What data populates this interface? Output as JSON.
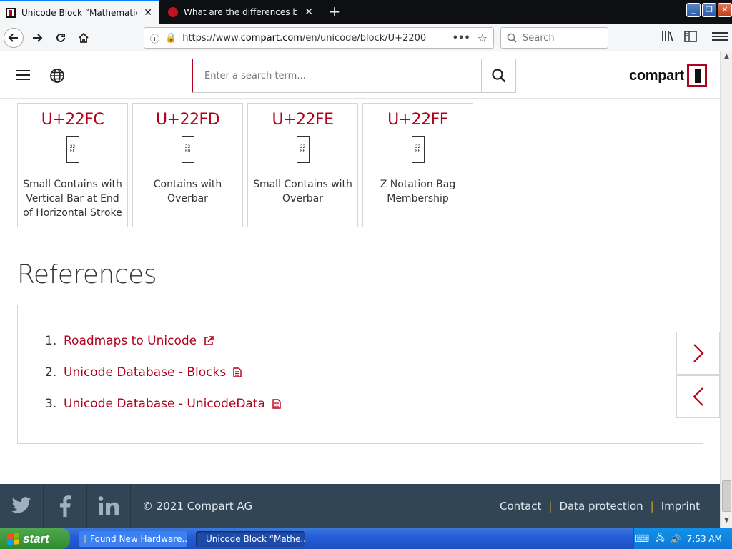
{
  "browser": {
    "tabs": [
      {
        "title": "Unicode Block “Mathematical Oper",
        "active": true
      },
      {
        "title": "What are the differences between",
        "active": false
      }
    ],
    "url": {
      "prefix": "https://www.",
      "domain": "compart.com",
      "path": "/en/unicode/block/U+2200"
    },
    "search_placeholder": "Search"
  },
  "site": {
    "search_placeholder": "Enter a search term...",
    "logo_text": "compart"
  },
  "cards": [
    {
      "code": "U+22FC",
      "glyph": "22 FC",
      "name": "Small Contains with Vertical Bar at End of Horizontal Stroke"
    },
    {
      "code": "U+22FD",
      "glyph": "22 FD",
      "name": "Contains with Overbar"
    },
    {
      "code": "U+22FE",
      "glyph": "22 FE",
      "name": "Small Contains with Overbar"
    },
    {
      "code": "U+22FF",
      "glyph": "22 FF",
      "name": "Z Notation Bag Membership"
    }
  ],
  "references": {
    "title": "References",
    "items": [
      {
        "num": "1.",
        "label": "Roadmaps to Unicode",
        "icon": "external-link-icon"
      },
      {
        "num": "2.",
        "label": "Unicode Database - Blocks",
        "icon": "document-icon"
      },
      {
        "num": "3.",
        "label": "Unicode Database - UnicodeData",
        "icon": "document-icon"
      }
    ]
  },
  "footer": {
    "copyright": "© 2021 Compart AG",
    "links": [
      "Contact",
      "Data protection",
      "Imprint"
    ],
    "separator": "|"
  },
  "taskbar": {
    "start_label": "start",
    "tasks": [
      "Found New Hardware...",
      "Unicode Block “Mathe..."
    ],
    "clock": "7:53 AM"
  }
}
